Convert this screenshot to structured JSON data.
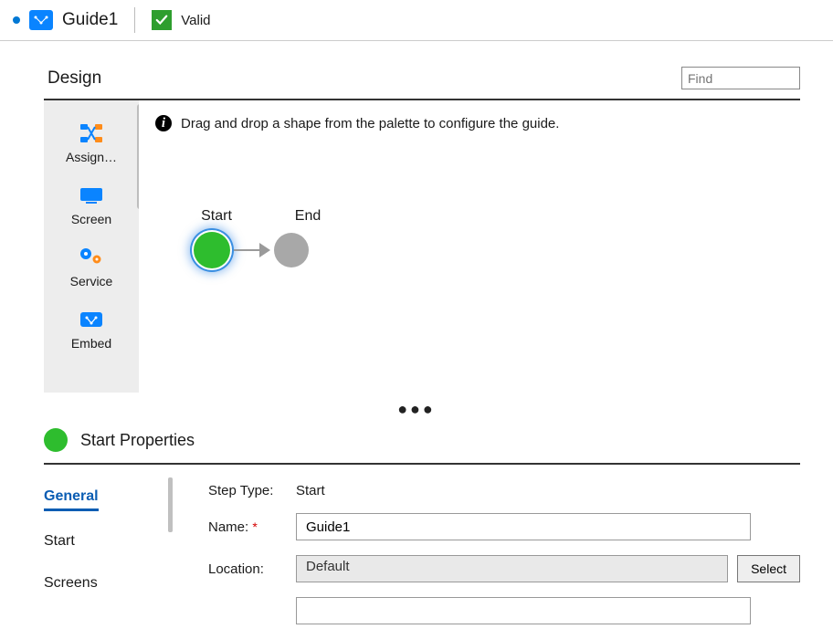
{
  "header": {
    "title": "Guide1",
    "valid_label": "Valid"
  },
  "design": {
    "title": "Design",
    "find_placeholder": "Find",
    "hint": "Drag and drop a shape from the palette to configure the guide.",
    "nodes": {
      "start_label": "Start",
      "end_label": "End"
    }
  },
  "palette": {
    "items": [
      "Assign…",
      "Screen",
      "Service",
      "Embed"
    ]
  },
  "properties": {
    "title": "Start Properties",
    "tabs": [
      "General",
      "Start",
      "Screens"
    ],
    "active_tab": "General",
    "step_type_label": "Step Type:",
    "step_type_value": "Start",
    "name_label": "Name:",
    "name_value": "Guide1",
    "location_label": "Location:",
    "location_value": "Default",
    "select_button": "Select"
  }
}
